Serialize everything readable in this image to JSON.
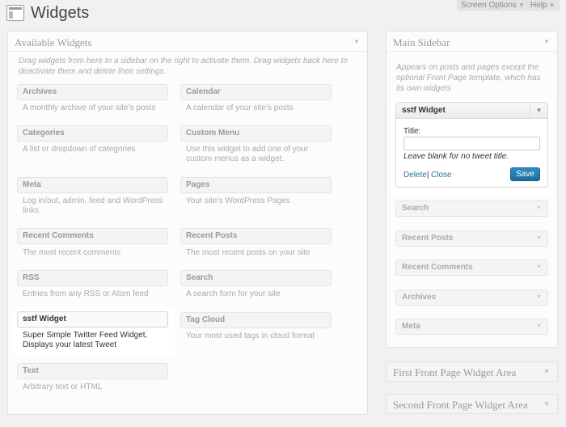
{
  "header": {
    "title": "Widgets",
    "screen_options": "Screen Options",
    "help": "Help"
  },
  "available": {
    "title": "Available Widgets",
    "description": "Drag widgets from here to a sidebar on the right to activate them. Drag widgets back here to deactivate them and delete their settings.",
    "widgets": [
      {
        "name": "Archives",
        "desc": "A monthly archive of your site’s posts"
      },
      {
        "name": "Calendar",
        "desc": "A calendar of your site’s posts"
      },
      {
        "name": "Categories",
        "desc": "A list or dropdown of categories"
      },
      {
        "name": "Custom Menu",
        "desc": "Use this widget to add one of your custom menus as a widget."
      },
      {
        "name": "Meta",
        "desc": "Log in/out, admin, feed and WordPress links"
      },
      {
        "name": "Pages",
        "desc": "Your site’s WordPress Pages"
      },
      {
        "name": "Recent Comments",
        "desc": "The most recent comments"
      },
      {
        "name": "Recent Posts",
        "desc": "The most recent posts on your site"
      },
      {
        "name": "RSS",
        "desc": "Entries from any RSS or Atom feed"
      },
      {
        "name": "Search",
        "desc": "A search form for your site"
      },
      {
        "name": "sstf Widget",
        "desc": "Super Simple Twitter Feed Widget, Displays your latest Tweet"
      },
      {
        "name": "Tag Cloud",
        "desc": "Your most used tags in cloud format"
      },
      {
        "name": "Text",
        "desc": "Arbitrary text or HTML"
      }
    ]
  },
  "main_sidebar": {
    "title": "Main Sidebar",
    "description": "Appears on posts and pages except the optional Front Page template, which has its own widgets",
    "expanded_widget": {
      "name": "sstf Widget",
      "title_label": "Title:",
      "title_value": "",
      "hint": "Leave blank for no tweet title.",
      "delete_label": "Delete",
      "separator": "|",
      "close_label": "Close",
      "save_label": "Save"
    },
    "widgets": [
      "Search",
      "Recent Posts",
      "Recent Comments",
      "Archives",
      "Meta"
    ]
  },
  "other_areas": [
    {
      "title": "First Front Page Widget Area"
    },
    {
      "title": "Second Front Page Widget Area"
    }
  ],
  "icons": {
    "arrow": "▼"
  },
  "colors": {
    "accent": "#21759b",
    "save_button": "#2583b8"
  }
}
